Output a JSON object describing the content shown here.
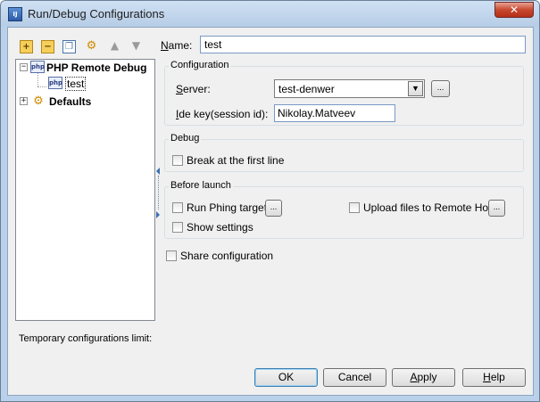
{
  "window": {
    "title": "Run/Debug Configurations",
    "app_icon_text": "IJ",
    "close_glyph": "✕"
  },
  "toolbar": {
    "add_icon": "add-icon",
    "remove_icon": "remove-icon",
    "copy_icon": "copy-icon",
    "edit_defaults_icon": "edit-defaults-icon",
    "move_up_icon": "arrow-up-icon",
    "move_down_icon": "arrow-down-icon"
  },
  "tree": {
    "root": {
      "label": "PHP Remote Debug",
      "expanded": true
    },
    "child": {
      "label": "test",
      "selected": true
    },
    "defaults": {
      "label": "Defaults",
      "expanded": false
    }
  },
  "temporary_limit_label": "Temporary configurations limit:",
  "name": {
    "label": "Name:",
    "value": "test"
  },
  "configuration": {
    "title": "Configuration",
    "server_label": "Server:",
    "server_value": "test-denwer",
    "ide_key_label": "Ide key(session id):",
    "ide_key_value": "Nikolay.Matveev"
  },
  "debug": {
    "title": "Debug",
    "break_first_line_label": "Break at the first line",
    "break_first_line_checked": false
  },
  "before_launch": {
    "title": "Before launch",
    "run_phing_label": "Run Phing target",
    "upload_files_label": "Upload files to Remote Host",
    "show_settings_label": "Show settings"
  },
  "share_configuration_label": "Share configuration",
  "buttons": {
    "ok": "OK",
    "cancel": "Cancel",
    "apply": "Apply",
    "help": "Help"
  },
  "ellipsis": "...",
  "colors": {
    "frame": "#b9d1ea",
    "client_bg": "#f0f0f0",
    "close_button": "#c8482f"
  }
}
